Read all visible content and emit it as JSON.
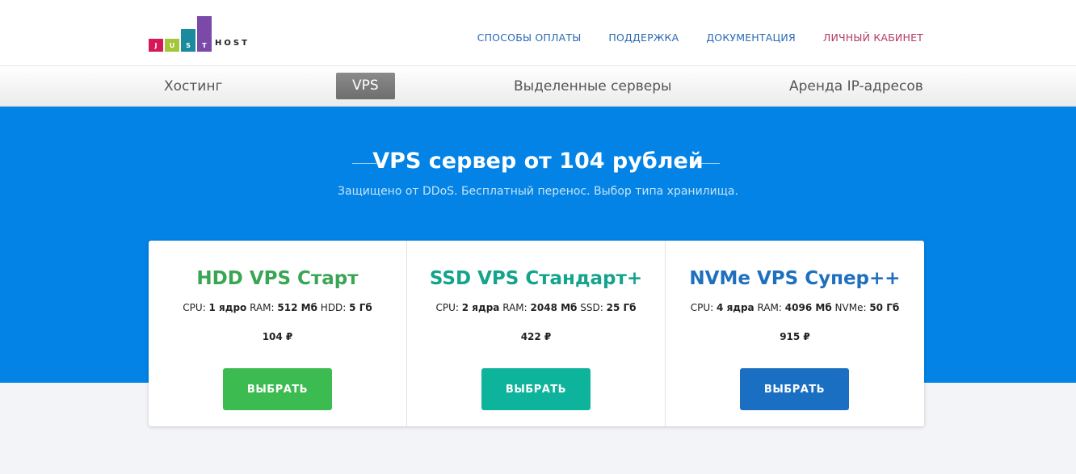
{
  "logo": {
    "letters": [
      "J",
      "U",
      "S",
      "T"
    ],
    "host": "HOST",
    "colors": [
      "#d6185a",
      "#a4c639",
      "#1c8a9e",
      "#7b4aa8"
    ]
  },
  "topnav": {
    "items": [
      {
        "label": "СПОСОБЫ ОПЛАТЫ"
      },
      {
        "label": "ПОДДЕРЖКА"
      },
      {
        "label": "ДОКУМЕНТАЦИЯ"
      },
      {
        "label": "ЛИЧНЫЙ КАБИНЕТ"
      }
    ]
  },
  "subnav": {
    "items": [
      {
        "label": "Хостинг"
      },
      {
        "label": "VPS",
        "active": true
      },
      {
        "label": "Выделенные серверы"
      },
      {
        "label": "Аренда IP-адресов"
      }
    ]
  },
  "hero": {
    "title": "VPS сервер от 104 рублей",
    "subtitle": "Защищено от DDoS. Бесплатный перенос. Выбор типа хранилища.",
    "background": "#0283e5"
  },
  "plans": [
    {
      "title": "HDD VPS Старт",
      "color": "#3aa655",
      "cpu_label": "CPU:",
      "cpu": "1 ядро",
      "ram_label": "RAM:",
      "ram": "512 Мб",
      "disk_label": "HDD:",
      "disk": "5 Гб",
      "price": "104 ₽",
      "button": "ВЫБРАТЬ",
      "button_color": "#3cbb50"
    },
    {
      "title": "SSD VPS Стандарт+",
      "color": "#14a38b",
      "cpu_label": "CPU:",
      "cpu": "2 ядра",
      "ram_label": "RAM:",
      "ram": "2048 Мб",
      "disk_label": "SSD:",
      "disk": "25 Гб",
      "price": "422 ₽",
      "button": "ВЫБРАТЬ",
      "button_color": "#0db39a"
    },
    {
      "title": "NVMe VPS Супер++",
      "color": "#1f6fbf",
      "cpu_label": "CPU:",
      "cpu": "4 ядра",
      "ram_label": "RAM:",
      "ram": "4096 Мб",
      "disk_label": "NVMe:",
      "disk": "50 Гб",
      "price": "915 ₽",
      "button": "ВЫБРАТЬ",
      "button_color": "#1a6fc2"
    }
  ]
}
